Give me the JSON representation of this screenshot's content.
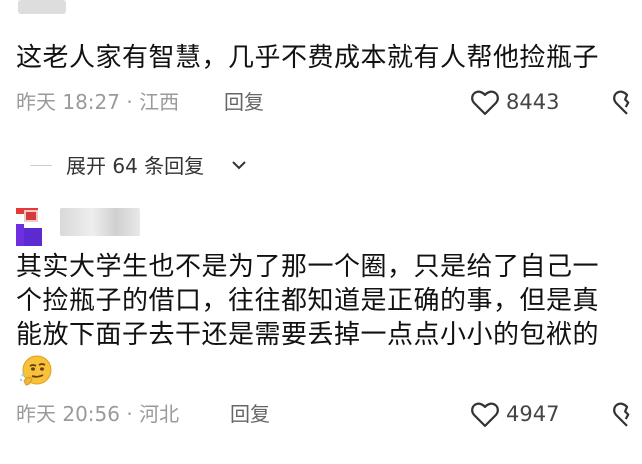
{
  "comment1": {
    "text": "这老人家有智慧，几乎不费成本就有人帮他捡瓶子",
    "meta": "昨天 18:27 · 江西",
    "reply_label": "回复",
    "likes": "8443"
  },
  "expand": {
    "label": "展开 64 条回复"
  },
  "comment2": {
    "line1": "其实大学生也不是为了那一个圈，只是给了自己一",
    "line2": "个捡瓶子的借口，往往都知道是正确的事，但是真",
    "line3": "能放下面子去干还是需要丢掉一点点小小的包袱的",
    "meta": "昨天 20:56 · 河北",
    "reply_label": "回复",
    "likes": "4947"
  },
  "colors": {
    "text": "#111111",
    "meta": "#9a9a9a",
    "avatar_accent": "#e53935",
    "avatar_purple": "#5b2bd1"
  }
}
